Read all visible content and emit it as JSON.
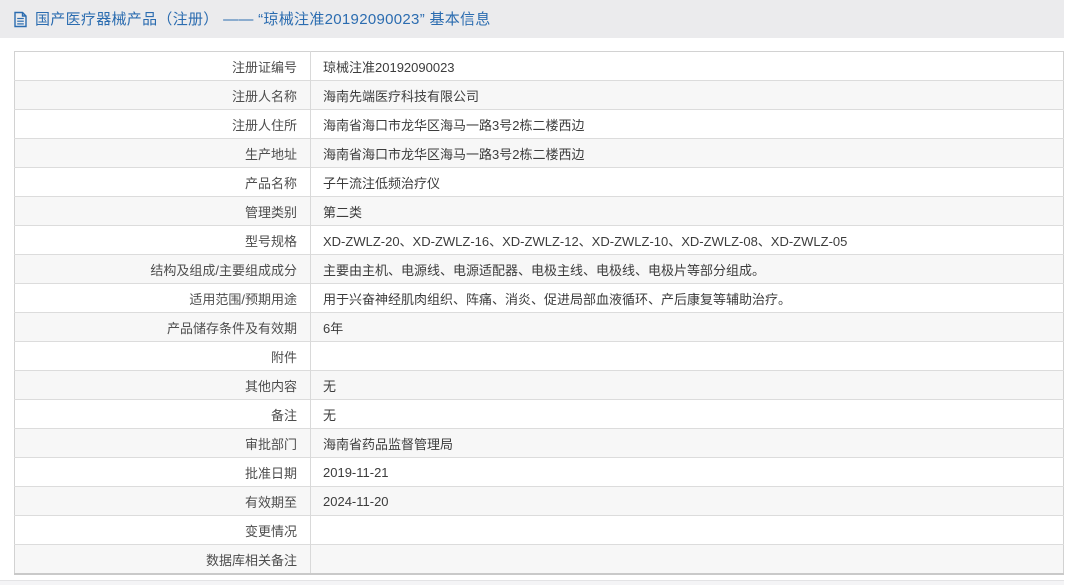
{
  "header": {
    "icon": "document-icon",
    "title": "国产医疗器械产品（注册） —— “琼械注准20192090023” 基本信息"
  },
  "colors": {
    "header_bg": "#ebebed",
    "title_blue": "#2b6cb0",
    "row_alt_bg": "#f7f7f7",
    "border": "#d9d9d9",
    "label_text": "#4d4d4d",
    "value_text": "#3c3c3c"
  },
  "table": {
    "rows": [
      {
        "label": "注册证编号",
        "value": "琼械注准20192090023"
      },
      {
        "label": "注册人名称",
        "value": "海南先端医疗科技有限公司"
      },
      {
        "label": "注册人住所",
        "value": "海南省海口市龙华区海马一路3号2栋二楼西边"
      },
      {
        "label": "生产地址",
        "value": "海南省海口市龙华区海马一路3号2栋二楼西边"
      },
      {
        "label": "产品名称",
        "value": "子午流注低频治疗仪"
      },
      {
        "label": "管理类别",
        "value": "第二类"
      },
      {
        "label": "型号规格",
        "value": "XD-ZWLZ-20、XD-ZWLZ-16、XD-ZWLZ-12、XD-ZWLZ-10、XD-ZWLZ-08、XD-ZWLZ-05"
      },
      {
        "label": "结构及组成/主要组成成分",
        "value": "主要由主机、电源线、电源适配器、电极主线、电极线、电极片等部分组成。"
      },
      {
        "label": "适用范围/预期用途",
        "value": "用于兴奋神经肌肉组织、阵痛、消炎、促进局部血液循环、产后康复等辅助治疗。"
      },
      {
        "label": "产品储存条件及有效期",
        "value": "6年"
      },
      {
        "label": "附件",
        "value": ""
      },
      {
        "label": "其他内容",
        "value": "无"
      },
      {
        "label": "备注",
        "value": "无"
      },
      {
        "label": "审批部门",
        "value": "海南省药品监督管理局"
      },
      {
        "label": "批准日期",
        "value": "2019-11-21"
      },
      {
        "label": "有效期至",
        "value": "2024-11-20"
      },
      {
        "label": "变更情况",
        "value": ""
      },
      {
        "label": "数据库相关备注",
        "value": ""
      }
    ]
  }
}
